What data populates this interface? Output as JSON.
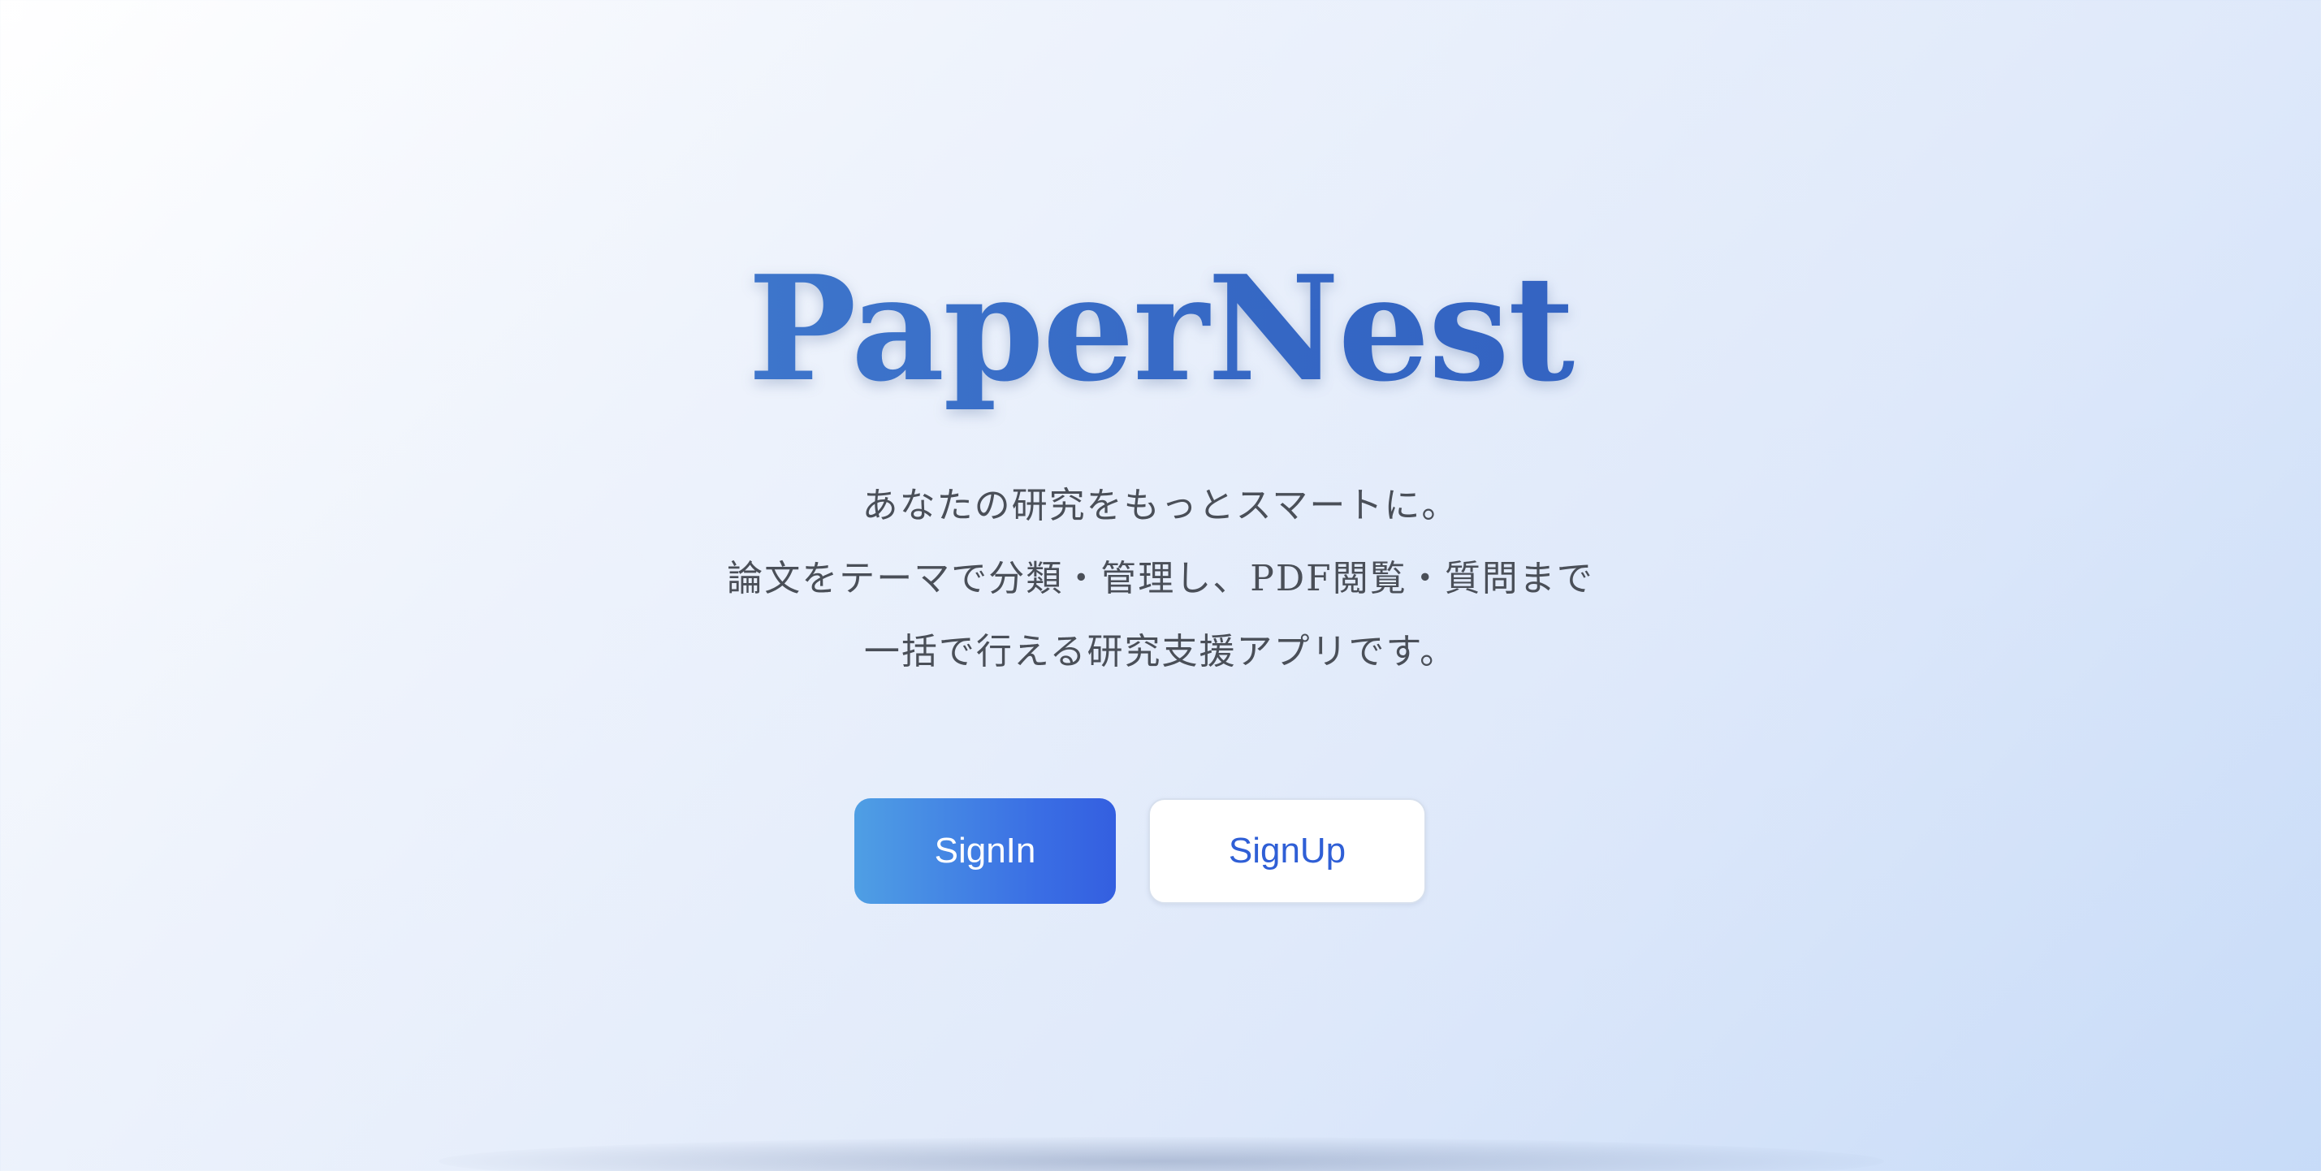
{
  "app": {
    "title": "PaperNest"
  },
  "tagline": {
    "lines": [
      "あなたの研究をもっとスマートに。",
      "論文をテーマで分類・管理し、PDF閲覧・質問まで",
      "一括で行える研究支援アプリです。"
    ]
  },
  "actions": {
    "signin_label": "SignIn",
    "signup_label": "SignUp"
  },
  "colors": {
    "accent": "#3a6ee4",
    "title_blue": "#3f78c9",
    "text_gray": "#4a4f58",
    "background_light": "#eef3fc"
  }
}
